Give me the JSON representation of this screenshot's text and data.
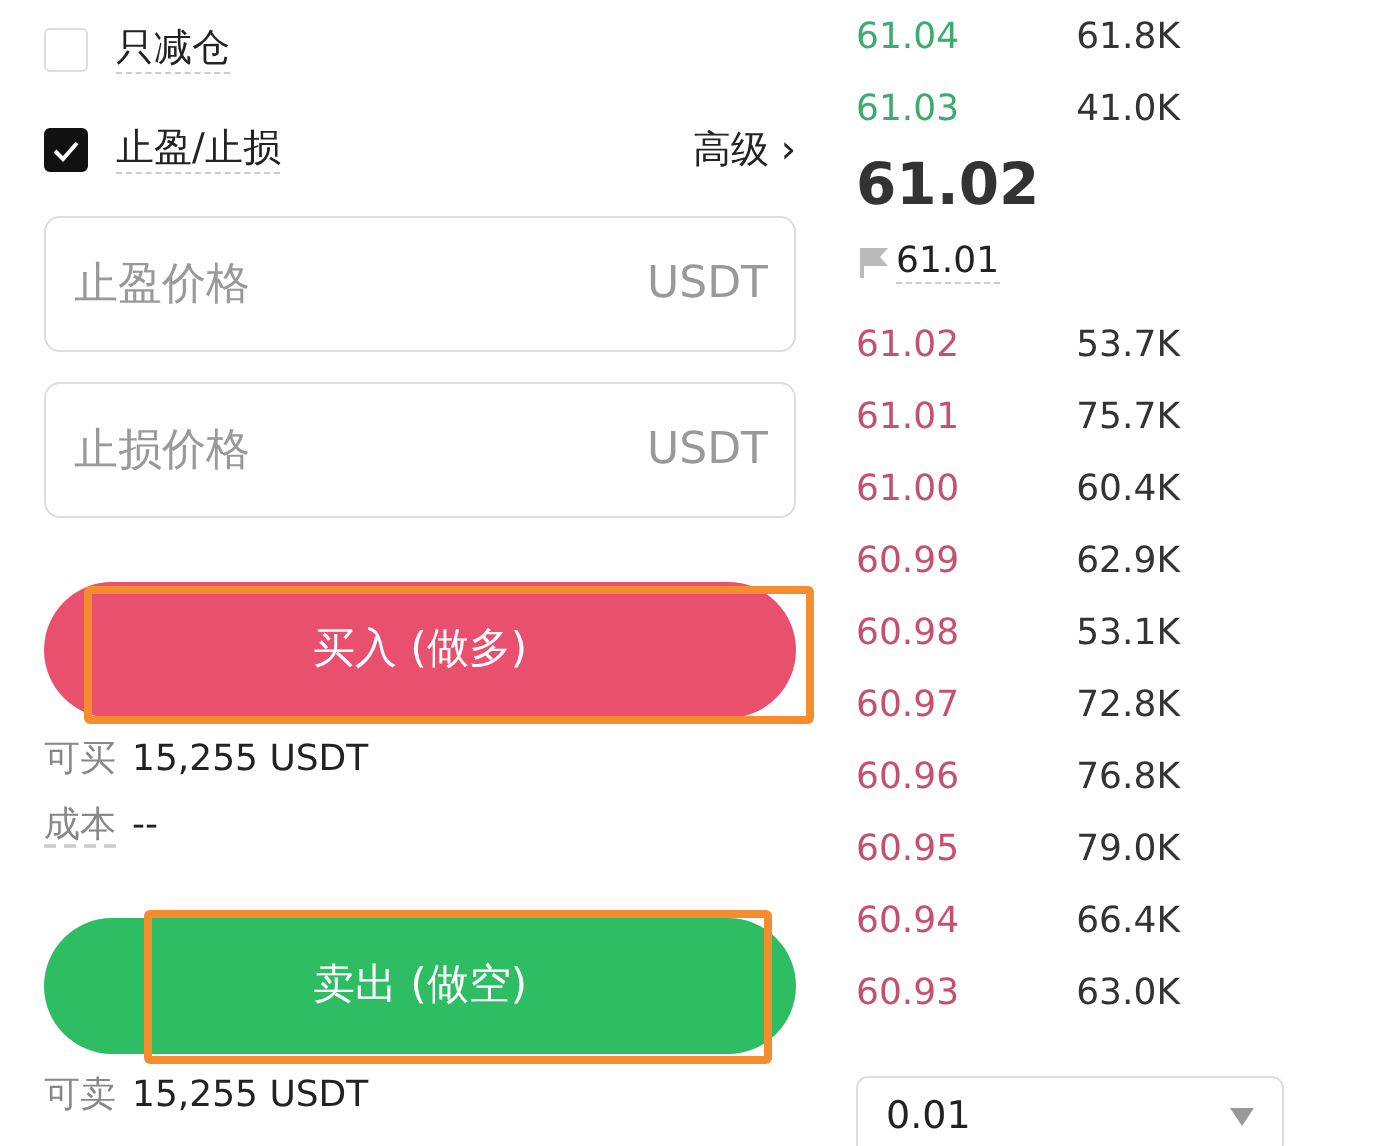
{
  "options": [
    {
      "label": "只减仓",
      "checked": false
    },
    {
      "label": "止盈/止损",
      "checked": true
    }
  ],
  "advanced_link": {
    "label": "高级",
    "icon": "›"
  },
  "fields": [
    {
      "placeholder": "止盈价格",
      "unit": "USDT"
    },
    {
      "placeholder": "止损价格",
      "unit": "USDT"
    }
  ],
  "actions": [
    {
      "kind": "buy",
      "label": "买入 (做多)",
      "highlighted": true,
      "info": [
        {
          "label": "可买",
          "amount": "15,255 USDT"
        },
        {
          "label": "成本",
          "amount": "--"
        }
      ]
    },
    {
      "kind": "sell",
      "label": "卖出 (做空)",
      "highlighted": true,
      "info": [
        {
          "label": "可卖",
          "amount": "15,255 USDT"
        }
      ]
    }
  ],
  "order_book": {
    "asks": [
      {
        "price": "61.04",
        "amount": "61.8K"
      },
      {
        "price": "61.03",
        "amount": "41.0K"
      }
    ],
    "last_price": "61.02",
    "mark_price": "61.01",
    "bids": [
      {
        "price": "61.02",
        "amount": "53.7K"
      },
      {
        "price": "61.01",
        "amount": "75.7K"
      },
      {
        "price": "61.00",
        "amount": "60.4K"
      },
      {
        "price": "60.99",
        "amount": "62.9K"
      },
      {
        "price": "60.98",
        "amount": "53.1K"
      },
      {
        "price": "60.97",
        "amount": "72.8K"
      },
      {
        "price": "60.96",
        "amount": "76.8K"
      },
      {
        "price": "60.95",
        "amount": "79.0K"
      },
      {
        "price": "60.94",
        "amount": "66.4K"
      },
      {
        "price": "60.93",
        "amount": "63.0K"
      }
    ],
    "precision_select": {
      "value": "0.01"
    }
  }
}
